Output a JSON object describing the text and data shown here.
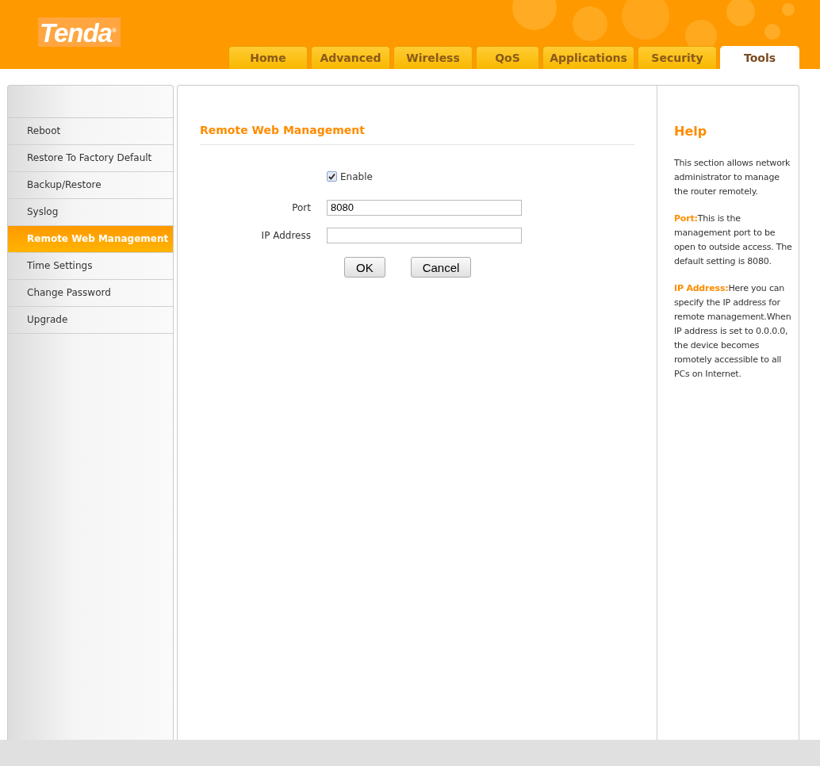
{
  "logo": "Tenda$^{®}$",
  "tabs": [
    {
      "label": "Home",
      "selected": false
    },
    {
      "label": "Advanced",
      "selected": false
    },
    {
      "label": "Wireless",
      "selected": false
    },
    {
      "label": "QoS",
      "selected": false
    },
    {
      "label": "Applications",
      "selected": false
    },
    {
      "label": "Security",
      "selected": false
    },
    {
      "label": "Tools",
      "selected": true
    }
  ],
  "sidebar": {
    "items": [
      {
        "label": "Reboot",
        "selected": false
      },
      {
        "label": "Restore To Factory Default",
        "selected": false
      },
      {
        "label": "Backup/Restore",
        "selected": false
      },
      {
        "label": "Syslog",
        "selected": false
      },
      {
        "label": "Remote Web Management",
        "selected": true
      },
      {
        "label": "Time Settings",
        "selected": false
      },
      {
        "label": "Change Password",
        "selected": false
      },
      {
        "label": "Upgrade",
        "selected": false
      }
    ]
  },
  "main": {
    "title": "Remote Web Management",
    "enable": {
      "label": "Enable",
      "checked": true
    },
    "fields": [
      {
        "label": "Port",
        "value": "8080"
      },
      {
        "label": "IP Address"
      }
    ],
    "buttons": [
      "OK",
      "Cancel"
    ]
  },
  "help": {
    "title": "Help",
    "paragraphs": [
      {
        "text": "This section allows network administrator to manage the router remotely."
      },
      {
        "term": "Port:",
        "text": "This is the management port to be open to outside access. The default setting is 8080."
      },
      {
        "term": "IP Address:",
        "text": "Here you can specify the IP address for remote management.When IP address is set to 0.0.0.0, the device becomes romotely accessible to all PCs on Internet."
      }
    ]
  }
}
